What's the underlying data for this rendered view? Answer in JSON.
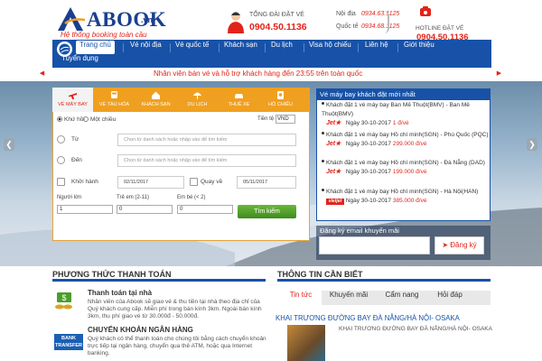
{
  "header": {
    "logo_text": "ABOOK",
    "logo_suffix": ".vn",
    "slogan": "Hệ thống booking toàn cầu",
    "call_label": "TỔNG ĐÀI ĐẶT VÉ",
    "call_number": "0904.50.1136",
    "domestic_label": "Nội địa",
    "domestic_number": "0934.63.1125",
    "intl_label": "Quốc tế",
    "intl_number": "0934.68.1125",
    "hotline_label": "HOTLINE ĐẶT VÉ",
    "hotline_number": "0904.50.1136"
  },
  "nav": {
    "items": [
      "Trang chủ",
      "Vé nội địa",
      "Vé quốc tế",
      "Khách sạn",
      "Du lịch",
      "Visa hộ chiếu",
      "Liên hệ",
      "Giới thiệu",
      "Tuyển dụng"
    ]
  },
  "ticker": {
    "text": "Nhân viên bán vé và hỗ trợ khách hàng đến 23:55 trên toàn quốc"
  },
  "search": {
    "tabs": [
      "VÉ MÁY BAY",
      "VÉ TÀU HỎA",
      "KHÁCH SẠN",
      "DU LỊCH",
      "THUÊ XE",
      "HỘ CHIẾU"
    ],
    "trip_roundtrip": "Khứ hồi",
    "trip_oneway": "Một chiều",
    "currency_label": "Tiền tệ",
    "currency": "VND",
    "from_label": "Từ",
    "from_placeholder": "Chọn từ danh sách hoặc nhập vào để tìm kiếm",
    "to_label": "Đến",
    "to_placeholder": "Chọn từ danh sách hoặc nhập vào để tìm kiếm",
    "depart_label": "Khởi hành",
    "depart_date": "02/11/2017",
    "return_label": "Quay về",
    "return_date": "05/11/2017",
    "adult_label": "Người lớn",
    "adult_value": "1",
    "child_label": "Trẻ em",
    "child_hint": "(2-11)",
    "child_value": "0",
    "infant_label": "Em bé",
    "infant_hint": "(< 2)",
    "infant_value": "0",
    "submit_label": "Tìm kiếm"
  },
  "recent": {
    "title": "Vé máy bay khách đặt mới nhất",
    "items": [
      {
        "text": "Khách đặt 1 vé máy bay Ban Mê Thuột(BMV) - Ban Mê Thuột(BMV)",
        "airline": "Jet★",
        "date": "Ngày 30-10-2017",
        "price": "1 đ/vé"
      },
      {
        "text": "Khách đặt 1 vé máy bay Hồ chí minh(SGN) - Phú Quốc (PQC)",
        "airline": "Jet★",
        "date": "Ngày 30-10-2017",
        "price": "299.000 đ/vé"
      },
      {
        "text": "Khách đặt 1 vé máy bay Hồ chí minh(SGN) - Đà Nẵng (DAD)",
        "airline": "Jet★",
        "date": "Ngày 30-10-2017",
        "price": "199.000 đ/vé"
      },
      {
        "text": "Khách đặt 1 vé máy bay Hồ chí minh(SGN) - Hà Nội(HAN)",
        "airline": "vietjet",
        "date": "Ngày 30-10-2017",
        "price": "385.000 đ/vé"
      }
    ]
  },
  "email": {
    "label": "Đăng ký email khuyến mãi",
    "button": "Đăng ký"
  },
  "payment": {
    "title": "PHƯƠNG THỨC THANH TOÁN",
    "items": [
      {
        "title": "Thanh toán tại nhà",
        "desc": "Nhân viên của Abook sẽ giao vé & thu tiền tại nhà theo địa chỉ của Quý khách cung cấp. Miễn phí trong bán kính 3km. Ngoài bán kính 3km, thu phí giao vé từ 30.000đ - 50.000đ."
      },
      {
        "title": "CHUYỂN KHOẢN NGÂN HÀNG",
        "desc": "Quý khách có thể thanh toán cho chúng tôi bằng cách chuyển khoản trực tiếp tại ngân hàng, chuyển qua thẻ ATM, hoặc qua Internet banking.",
        "icon_text": "BANK TRANSFER"
      }
    ]
  },
  "info": {
    "title": "THÔNG TIN CẦN BIẾT",
    "tabs": [
      "Tin tức",
      "Khuyến mãi",
      "Cẩm nang",
      "Hỏi đáp"
    ],
    "news_title": "KHAI TRƯƠNG ĐƯỜNG BAY ĐÀ NẴNG/HÀ NỘI- OSAKA",
    "news_desc": "KHAI TRƯƠNG ĐƯỜNG BAY ĐÀ NẴNG/HÀ NỘI- OSAKA"
  },
  "colors": {
    "brand_blue": "#1752a8",
    "accent_orange": "#f0a020",
    "red": "#e2231a",
    "green": "#4a9e2a"
  }
}
